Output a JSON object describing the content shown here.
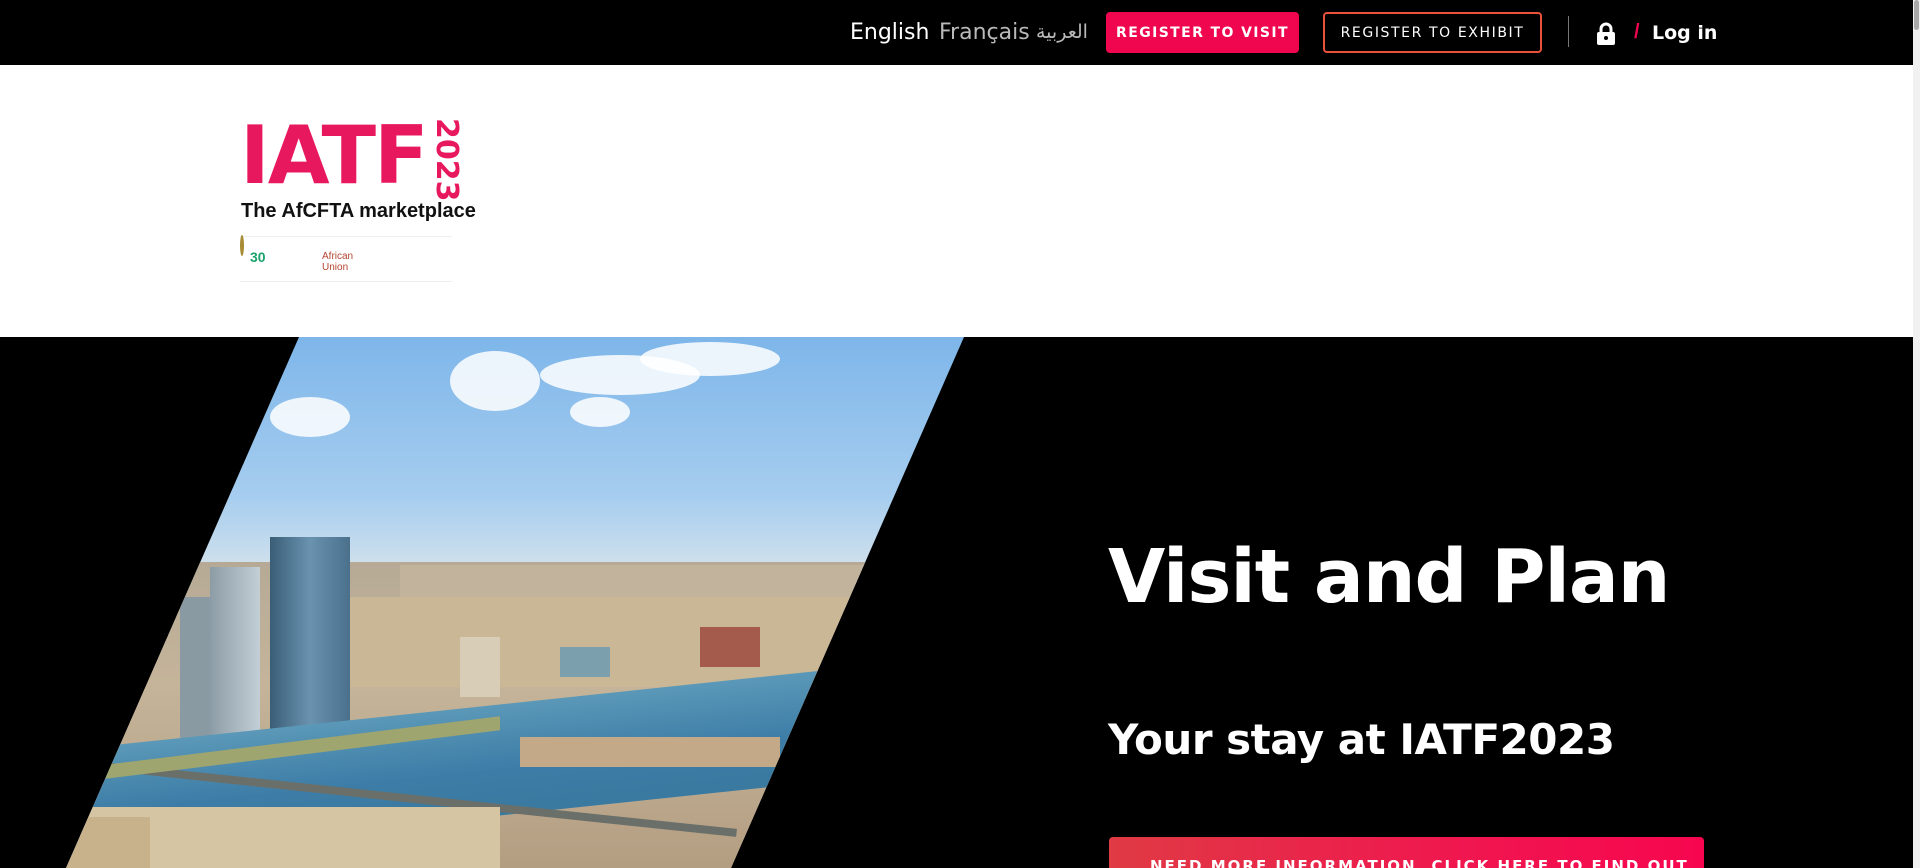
{
  "topbar": {
    "languages": {
      "english": "English",
      "french": "Français",
      "arabic": "العربية"
    },
    "register_visit": "REGISTER TO VISIT",
    "register_exhibit": "REGISTER TO EXHIBIT",
    "slash": "/",
    "login": "Log in"
  },
  "logo": {
    "main": "IATF",
    "year": "2023",
    "tagline": "The AfCFTA marketplace",
    "sponsors": {
      "left": "30",
      "middle_line1": "African",
      "middle_line2": "Union"
    }
  },
  "hero": {
    "title": "Visit and Plan",
    "subtitle": "Your stay at IATF2023",
    "cta": "NEED MORE INFORMATION, CLICK HERE TO FIND OUT"
  },
  "colors": {
    "accent": "#f0064f",
    "exhibit_border": "#e8523a",
    "logo": "#e8185e",
    "background": "#000000"
  },
  "icons": {
    "lock": "lock-icon"
  }
}
